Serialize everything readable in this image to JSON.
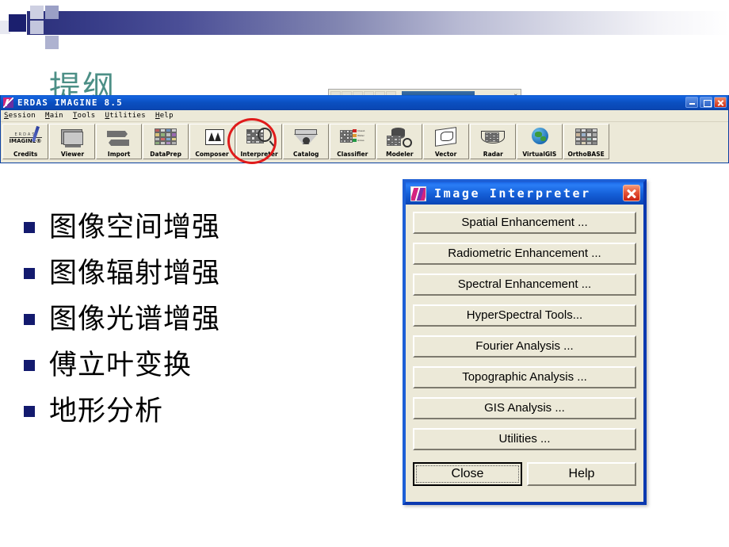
{
  "slide": {
    "title": "提纲",
    "bullets": [
      {
        "text": "图像空间增强"
      },
      {
        "text": "图像辐射增强"
      },
      {
        "text": "图像光谱增强"
      },
      {
        "text": "傅立叶变换"
      },
      {
        "text": "地形分析"
      }
    ],
    "accent_color": "#131a6e",
    "title_color": "#4c8f86",
    "banner_color": "#2b2f7a"
  },
  "erdas_window": {
    "title": "ERDAS IMAGINE 8.5",
    "logo_icon": "erdas-imagine-logo-icon",
    "window_buttons": [
      {
        "name": "minimize-button",
        "icon": "minimize-icon"
      },
      {
        "name": "maximize-button",
        "icon": "maximize-icon"
      },
      {
        "name": "close-button",
        "icon": "close-icon"
      }
    ],
    "menus": [
      {
        "accel": "S",
        "rest": "ession"
      },
      {
        "accel": "M",
        "rest": "ain"
      },
      {
        "accel": "T",
        "rest": "ools"
      },
      {
        "accel": "U",
        "rest": "tilities"
      },
      {
        "accel": "H",
        "rest": "elp"
      }
    ],
    "toolbar": [
      {
        "label": "Credits",
        "icon": "erdas-credits-icon",
        "highlighted": false
      },
      {
        "label": "Viewer",
        "icon": "viewer-monitor-icon",
        "highlighted": false
      },
      {
        "label": "Import",
        "icon": "import-arrows-icon",
        "highlighted": false
      },
      {
        "label": "DataPrep",
        "icon": "dataprep-grid-icon",
        "highlighted": false
      },
      {
        "label": "Composer",
        "icon": "composer-map-icon",
        "highlighted": false
      },
      {
        "label": "Interpreter",
        "icon": "interpreter-magnifier-icon",
        "highlighted": true
      },
      {
        "label": "Catalog",
        "icon": "catalog-funnel-icon",
        "highlighted": false
      },
      {
        "label": "Classifier",
        "icon": "classifier-legend-icon",
        "highlighted": false
      },
      {
        "label": "Modeler",
        "icon": "modeler-stack-icon",
        "highlighted": false
      },
      {
        "label": "Vector",
        "icon": "vector-polygon-icon",
        "highlighted": false
      },
      {
        "label": "Radar",
        "icon": "radar-fan-icon",
        "highlighted": false
      },
      {
        "label": "VirtualGIS",
        "icon": "globe-icon",
        "highlighted": false
      },
      {
        "label": "OrthoBASE",
        "icon": "orthobase-grid-icon",
        "highlighted": false
      }
    ],
    "annotation": {
      "shape": "red-ellipse",
      "target": "Interpreter",
      "color": "#e01b1b"
    }
  },
  "dialog": {
    "title": "Image Interpreter",
    "logo_icon": "imagine-logo-icon",
    "close_icon": "close-icon",
    "buttons": [
      {
        "label": "Spatial Enhancement ..."
      },
      {
        "label": "Radiometric Enhancement ..."
      },
      {
        "label": "Spectral Enhancement ..."
      },
      {
        "label": "HyperSpectral Tools..."
      },
      {
        "label": "Fourier Analysis ..."
      },
      {
        "label": "Topographic Analysis ..."
      },
      {
        "label": "GIS Analysis ..."
      },
      {
        "label": "Utilities ..."
      }
    ],
    "footer": {
      "close_label": "Close",
      "help_label": "Help"
    },
    "title_bar_color": "#1560d8",
    "face_color": "#ece9d8"
  }
}
